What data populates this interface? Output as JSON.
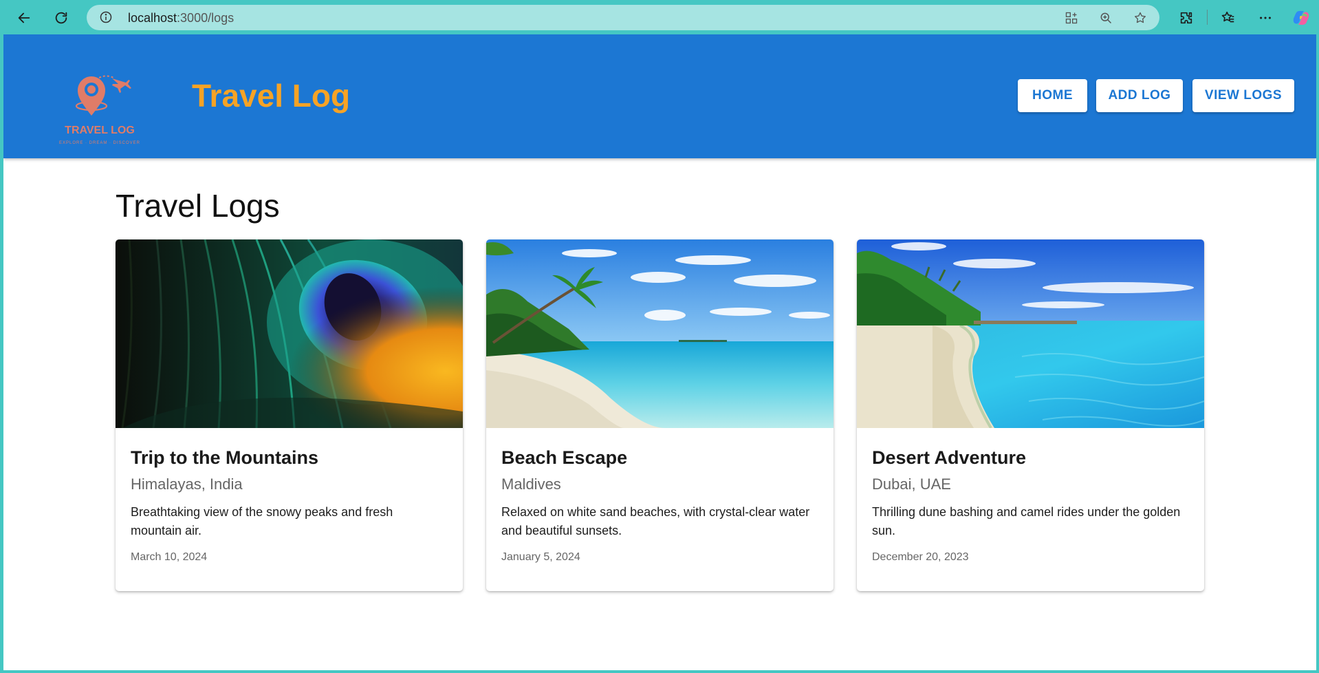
{
  "browser": {
    "url_host": "localhost",
    "url_path": ":3000/logs"
  },
  "header": {
    "logo_text": "TRAVEL LOG",
    "logo_tagline": "EXPLORE · DREAM · DISCOVER",
    "title": "Travel Log",
    "nav": [
      {
        "label": "HOME"
      },
      {
        "label": "ADD LOG"
      },
      {
        "label": "VIEW LOGS"
      }
    ]
  },
  "main": {
    "title": "Travel Logs",
    "cards": [
      {
        "title": "Trip to the Mountains",
        "location": "Himalayas, India",
        "description": "Breathtaking view of the snowy peaks and fresh mountain air.",
        "date": "March 10, 2024",
        "image": "peacock-feather"
      },
      {
        "title": "Beach Escape",
        "location": "Maldives",
        "description": "Relaxed on white sand beaches, with crystal-clear water and beautiful sunsets.",
        "date": "January 5, 2024",
        "image": "tropical-beach"
      },
      {
        "title": "Desert Adventure",
        "location": "Dubai, UAE",
        "description": "Thrilling dune bashing and camel rides under the golden sun.",
        "date": "December 20, 2023",
        "image": "beach-shoreline"
      }
    ]
  },
  "colors": {
    "browser_frame": "#45c7c3",
    "header_bg": "#1c77d3",
    "brand_orange": "#f7a325",
    "nav_text": "#1c77d3"
  }
}
